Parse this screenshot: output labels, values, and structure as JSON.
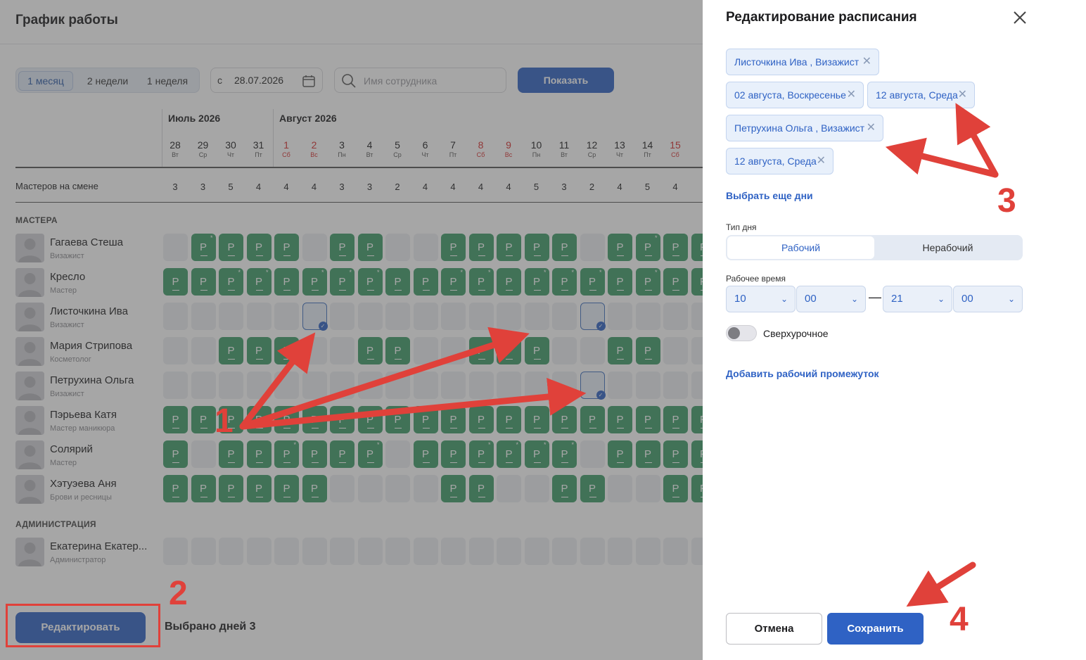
{
  "page": {
    "title": "График работы"
  },
  "period": {
    "options": [
      "1 месяц",
      "2 недели",
      "1 неделя"
    ],
    "active": "1 месяц",
    "date_prefix": "с",
    "date": "28.07.2026",
    "search_placeholder": "Имя сотрудника",
    "show_label": "Показать"
  },
  "months": [
    {
      "label": "Июль 2026"
    },
    {
      "label": "Август 2026"
    }
  ],
  "days": [
    {
      "n": "28",
      "w": "Вт",
      "wk": false
    },
    {
      "n": "29",
      "w": "Ср",
      "wk": false
    },
    {
      "n": "30",
      "w": "Чт",
      "wk": false
    },
    {
      "n": "31",
      "w": "Пт",
      "wk": false
    },
    {
      "n": "1",
      "w": "Сб",
      "wk": true
    },
    {
      "n": "2",
      "w": "Вс",
      "wk": true
    },
    {
      "n": "3",
      "w": "Пн",
      "wk": false
    },
    {
      "n": "4",
      "w": "Вт",
      "wk": false
    },
    {
      "n": "5",
      "w": "Ср",
      "wk": false
    },
    {
      "n": "6",
      "w": "Чт",
      "wk": false
    },
    {
      "n": "7",
      "w": "Пт",
      "wk": false
    },
    {
      "n": "8",
      "w": "Сб",
      "wk": true
    },
    {
      "n": "9",
      "w": "Вс",
      "wk": true
    },
    {
      "n": "10",
      "w": "Пн",
      "wk": false
    },
    {
      "n": "11",
      "w": "Вт",
      "wk": false
    },
    {
      "n": "12",
      "w": "Ср",
      "wk": false
    },
    {
      "n": "13",
      "w": "Чт",
      "wk": false
    },
    {
      "n": "14",
      "w": "Пт",
      "wk": false
    },
    {
      "n": "15",
      "w": "Сб",
      "wk": true
    }
  ],
  "count_label": "Мастеров на смене",
  "counts": [
    "3",
    "3",
    "5",
    "4",
    "4",
    "4",
    "3",
    "3",
    "2",
    "4",
    "4",
    "4",
    "4",
    "5",
    "3",
    "2",
    "4",
    "5",
    "4"
  ],
  "sections": {
    "masters": "МАСТЕРА",
    "admin": "АДМИНИСТРАЦИЯ"
  },
  "cell_letter": "Р",
  "employees": [
    {
      "name": "Гагаева Стеша",
      "role": "Визажист",
      "cells": "_RRrr_RR__RRRRR_RRRR",
      "marks": "-+---------------+--+"
    },
    {
      "name": "Кресло",
      "role": "Мастер",
      "cells": "RRRRRRRRRRRRRRRRRRRR",
      "marks": "--++-+++--++-+++-+--+"
    },
    {
      "name": "Листочкина Ива",
      "role": "Визажист",
      "cells": "_____S_________S____",
      "marks": "----------------------"
    },
    {
      "name": "Мария Стрипова",
      "role": "Косметолог",
      "cells": "__RRR__RR__RRR__RR__",
      "marks": "--------------------"
    },
    {
      "name": "Петрухина Ольга",
      "role": "Визажист",
      "cells": "_______________S____",
      "marks": "--------------------"
    },
    {
      "name": "Пэрьева Катя",
      "role": "Мастер маникюра",
      "cells": "RRRRRRRRRRRRRRRRRRRR",
      "marks": "--------------------"
    },
    {
      "name": "Солярий",
      "role": "Мастер",
      "cells": "R_RRRRRR_RRRRRR_RRRR",
      "marks": "----+--++--+++++---+-"
    },
    {
      "name": "Хэтуэева Аня",
      "role": "Брови и ресницы",
      "cells": "RRRRRR____RR__RR__RR",
      "marks": "--------------------"
    }
  ],
  "admins": [
    {
      "name": "Екатерина Екатер...",
      "role": "Администратор"
    }
  ],
  "bottom": {
    "edit_label": "Редактировать",
    "selected_label": "Выбрано дней 3"
  },
  "panel": {
    "title": "Редактирование расписания",
    "chips": [
      "Листочкина Ива , Визажист",
      "02 августа, Воскресенье",
      "12 августа, Среда",
      "Петрухина Ольга , Визажист",
      "12 августа, Среда"
    ],
    "more_days": "Выбрать еще дни",
    "day_type_label": "Тип дня",
    "day_type_options": [
      "Рабочий",
      "Нерабочий"
    ],
    "work_time_label": "Рабочее время",
    "time": [
      "10",
      "00",
      "21",
      "00"
    ],
    "time_sep": "—",
    "overtime_label": "Сверхурочное",
    "add_interval": "Добавить рабочий промежуток",
    "cancel_label": "Отмена",
    "save_label": "Сохранить"
  },
  "annotations": [
    "1",
    "2",
    "3",
    "4"
  ],
  "colors": {
    "accent": "#2f62c4",
    "work": "#3e9c68",
    "annot": "#e0413a",
    "weekend": "#d62c2c"
  }
}
